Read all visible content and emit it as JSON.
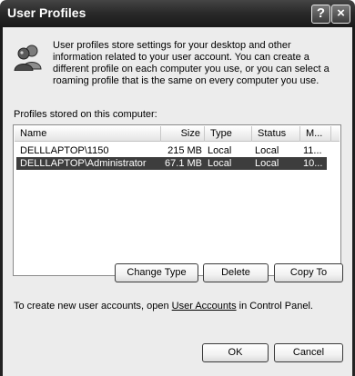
{
  "window": {
    "title": "User Profiles",
    "help_glyph": "?",
    "close_glyph": "×"
  },
  "intro": {
    "icon": "users-icon",
    "text": "User profiles store settings for your desktop and other information related to your user account. You can create a different profile on each computer you use, or you can select a roaming profile that is the same on every computer you use."
  },
  "profiles": {
    "label": "Profiles stored on this computer:",
    "columns": [
      "Name",
      "Size",
      "Type",
      "Status",
      "M..."
    ],
    "rows": [
      {
        "name": "DELLLAPTOP\\1150",
        "size": "215 MB",
        "type": "Local",
        "status": "Local",
        "modified": "11...",
        "selected": false
      },
      {
        "name": "DELLLAPTOP\\Administrator",
        "size": "67.1 MB",
        "type": "Local",
        "status": "Local",
        "modified": "10...",
        "selected": true
      }
    ]
  },
  "actions": {
    "change_type": "Change Type",
    "delete": "Delete",
    "copy_to": "Copy To"
  },
  "footer": {
    "prefix": "To create new user accounts, open ",
    "link": "User Accounts",
    "suffix": " in Control Panel."
  },
  "dialog": {
    "ok": "OK",
    "cancel": "Cancel"
  }
}
